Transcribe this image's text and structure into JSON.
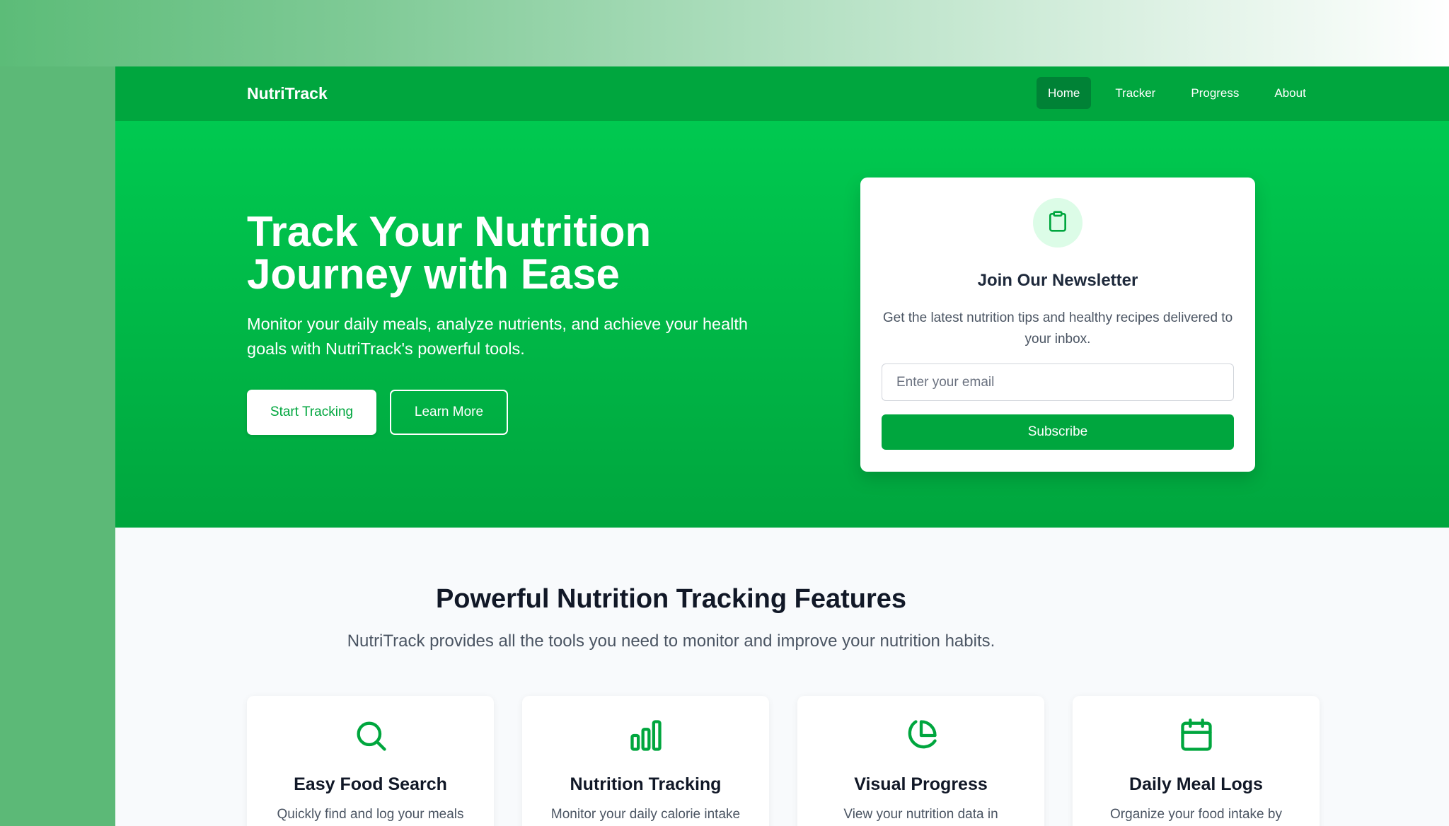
{
  "nav": {
    "brand": "NutriTrack",
    "links": [
      {
        "label": "Home",
        "active": true
      },
      {
        "label": "Tracker",
        "active": false
      },
      {
        "label": "Progress",
        "active": false
      },
      {
        "label": "About",
        "active": false
      }
    ]
  },
  "hero": {
    "title_line1": "Track Your Nutrition",
    "title_line2": "Journey with Ease",
    "subtitle": "Monitor your daily meals, analyze nutrients, and achieve your health goals with NutriTrack's powerful tools.",
    "primary_button": "Start Tracking",
    "secondary_button": "Learn More"
  },
  "newsletter": {
    "icon": "clipboard-icon",
    "title": "Join Our Newsletter",
    "description": "Get the latest nutrition tips and healthy recipes delivered to your inbox.",
    "email_placeholder": "Enter your email",
    "email_value": "",
    "button": "Subscribe"
  },
  "features": {
    "title": "Powerful Nutrition Tracking Features",
    "subtitle": "NutriTrack provides all the tools you need to monitor and improve your nutrition habits.",
    "items": [
      {
        "icon": "search-icon",
        "title": "Easy Food Search",
        "description": "Quickly find and log your meals"
      },
      {
        "icon": "bar-chart-icon",
        "title": "Nutrition Tracking",
        "description": "Monitor your daily calorie intake"
      },
      {
        "icon": "pie-chart-icon",
        "title": "Visual Progress",
        "description": "View your nutrition data in"
      },
      {
        "icon": "calendar-icon",
        "title": "Daily Meal Logs",
        "description": "Organize your food intake by"
      }
    ]
  },
  "colors": {
    "brand_green": "#00a63e",
    "hero_green_top": "#00c950",
    "nav_active": "#008236",
    "icon_bg": "#dcfce7"
  }
}
